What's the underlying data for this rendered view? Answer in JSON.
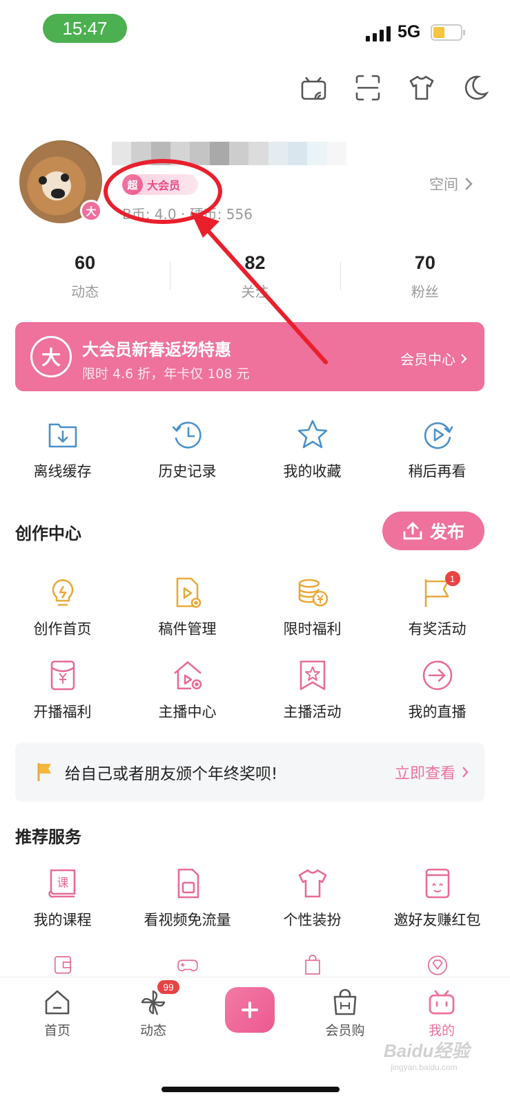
{
  "status_bar": {
    "time": "15:47",
    "network": "5G"
  },
  "profile": {
    "vip_badge_symbol": "超",
    "vip_label": "大会员",
    "avatar_badge": "大",
    "coins": "B币: 4.0  ·  硬币: 556",
    "space_link": "空间"
  },
  "stats": [
    {
      "value": "60",
      "label": "动态"
    },
    {
      "value": "82",
      "label": "关注"
    },
    {
      "value": "70",
      "label": "粉丝"
    }
  ],
  "vip_banner": {
    "icon_text": "大",
    "title": "大会员新春返场特惠",
    "subtitle": "限时 4.6 折，年卡仅 108 元",
    "link": "会员中心"
  },
  "quick_actions": [
    {
      "label": "离线缓存",
      "icon": "offline-cache-icon"
    },
    {
      "label": "历史记录",
      "icon": "history-icon"
    },
    {
      "label": "我的收藏",
      "icon": "favorites-star-icon"
    },
    {
      "label": "稍后再看",
      "icon": "watch-later-icon"
    }
  ],
  "creation_center": {
    "title": "创作中心",
    "publish_label": "发布",
    "row1": [
      {
        "label": "创作首页",
        "icon": "lightbulb-icon"
      },
      {
        "label": "稿件管理",
        "icon": "manuscript-icon"
      },
      {
        "label": "限时福利",
        "icon": "coins-icon"
      },
      {
        "label": "有奖活动",
        "icon": "flag-icon",
        "badge": "1"
      }
    ],
    "row2": [
      {
        "label": "开播福利",
        "icon": "red-envelope-icon"
      },
      {
        "label": "主播中心",
        "icon": "streamer-home-icon"
      },
      {
        "label": "主播活动",
        "icon": "bookmark-star-icon"
      },
      {
        "label": "我的直播",
        "icon": "live-enter-icon"
      }
    ]
  },
  "notice": {
    "text": "给自己或者朋友颁个年终奖呗!",
    "link": "立即查看"
  },
  "recommended": {
    "title": "推荐服务",
    "row1": [
      {
        "label": "我的课程",
        "icon": "course-icon"
      },
      {
        "label": "看视频免流量",
        "icon": "sim-card-icon"
      },
      {
        "label": "个性装扮",
        "icon": "tshirt-icon"
      },
      {
        "label": "邀好友赚红包",
        "icon": "invite-envelope-icon"
      }
    ]
  },
  "bottom_nav": [
    {
      "label": "首页",
      "icon": "home-icon"
    },
    {
      "label": "动态",
      "icon": "pinwheel-icon",
      "badge": "99"
    },
    {
      "label": "",
      "icon": "plus-icon"
    },
    {
      "label": "会员购",
      "icon": "shopping-bag-icon"
    },
    {
      "label": "我的",
      "icon": "tv-mascot-icon"
    }
  ],
  "colors": {
    "accent": "#ee729b",
    "annotation": "#ea1f2c",
    "status_green": "#4cb050"
  },
  "watermark": {
    "text": "Baidu经验",
    "sub": "jingyan.baidu.com"
  }
}
